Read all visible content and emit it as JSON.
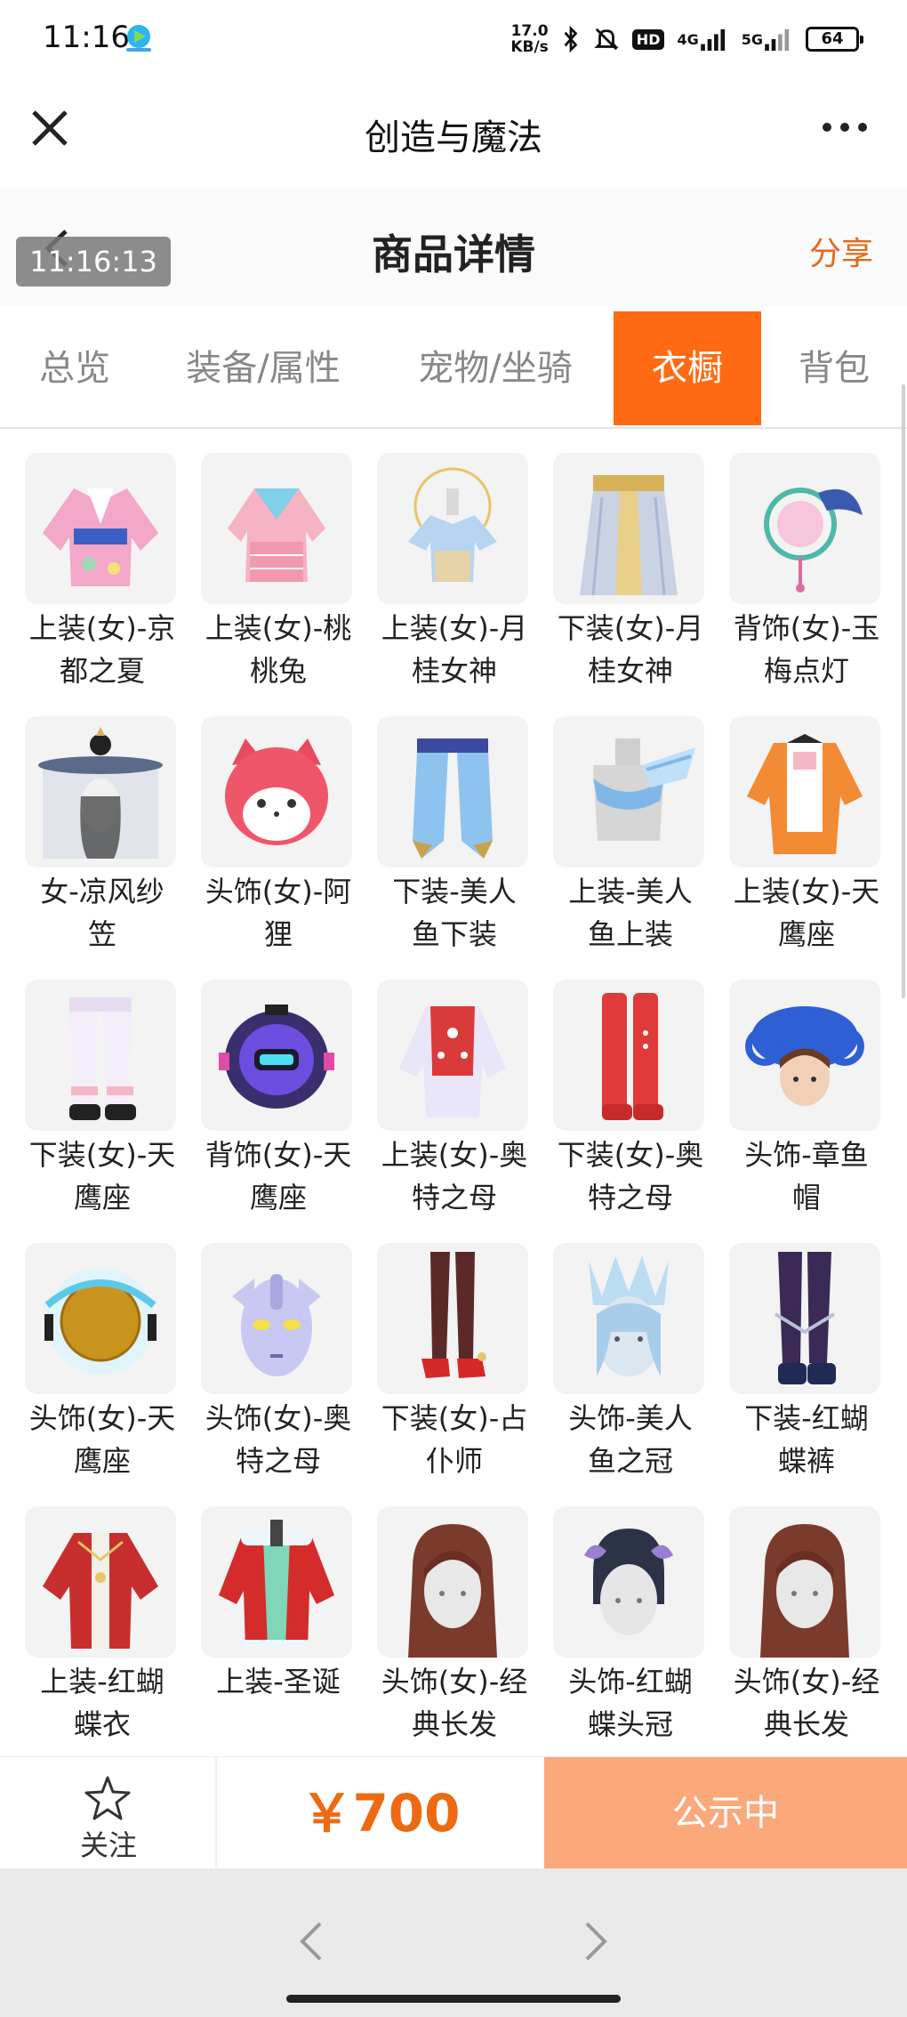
{
  "status_bar": {
    "time": "11:16",
    "net_speed_value": "17.0",
    "net_speed_unit": "KB/s",
    "hd_label": "HD",
    "signal1_label": "4G",
    "signal2_label": "5G",
    "battery": "64"
  },
  "title_bar": {
    "title": "创造与魔法"
  },
  "page_header": {
    "title": "商品详情",
    "share_label": "分享",
    "timestamp_overlay": "11:16:13"
  },
  "tabs": [
    {
      "label": "总览",
      "active": false
    },
    {
      "label": "装备/属性",
      "active": false
    },
    {
      "label": "宠物/坐骑",
      "active": false
    },
    {
      "label": "衣橱",
      "active": true
    },
    {
      "label": "背包",
      "active": false
    }
  ],
  "items": [
    {
      "line1": "上装(女)-京",
      "line2": "都之夏",
      "icon": "kimono-top-icon"
    },
    {
      "line1": "上装(女)-桃",
      "line2": "桃兔",
      "icon": "pink-dress-top-icon"
    },
    {
      "line1": "上装(女)-月",
      "line2": "桂女神",
      "icon": "goddess-top-icon"
    },
    {
      "line1": "下装(女)-月",
      "line2": "桂女神",
      "icon": "goddess-skirt-icon"
    },
    {
      "line1": "背饰(女)-玉",
      "line2": "梅点灯",
      "icon": "lantern-back-icon"
    },
    {
      "line1": "女-凉风纱",
      "line2": "笠",
      "icon": "veil-hat-icon"
    },
    {
      "line1": "头饰(女)-阿",
      "line2": "狸",
      "icon": "fox-head-icon"
    },
    {
      "line1": "下装-美人",
      "line2": "鱼下装",
      "icon": "mermaid-bottom-icon"
    },
    {
      "line1": "上装-美人",
      "line2": "鱼上装",
      "icon": "mermaid-top-icon"
    },
    {
      "line1": "上装(女)-天",
      "line2": "鹰座",
      "icon": "aquila-top-icon"
    },
    {
      "line1": "下装(女)-天",
      "line2": "鹰座",
      "icon": "aquila-pants-icon"
    },
    {
      "line1": "背饰(女)-天",
      "line2": "鹰座",
      "icon": "aquila-back-icon"
    },
    {
      "line1": "上装(女)-奥",
      "line2": "特之母",
      "icon": "ultra-top-icon"
    },
    {
      "line1": "下装(女)-奥",
      "line2": "特之母",
      "icon": "ultra-boots-icon"
    },
    {
      "line1": "头饰-章鱼",
      "line2": "帽",
      "icon": "octopus-hat-icon"
    },
    {
      "line1": "头饰(女)-天",
      "line2": "鹰座",
      "icon": "aquila-helmet-icon"
    },
    {
      "line1": "头饰(女)-奥",
      "line2": "特之母",
      "icon": "ultra-mask-icon"
    },
    {
      "line1": "下装(女)-占",
      "line2": "仆师",
      "icon": "red-heels-icon"
    },
    {
      "line1": "头饰-美人",
      "line2": "鱼之冠",
      "icon": "mermaid-crown-icon"
    },
    {
      "line1": "下装-红蝴",
      "line2": "蝶裤",
      "icon": "butterfly-pants-icon"
    },
    {
      "line1": "上装-红蝴",
      "line2": "蝶衣",
      "icon": "butterfly-top-icon"
    },
    {
      "line1": "上装-圣诞",
      "line2": "",
      "icon": "christmas-top-icon"
    },
    {
      "line1": "头饰(女)-经",
      "line2": "典长发",
      "icon": "long-hair-icon"
    },
    {
      "line1": "头饰-红蝴",
      "line2": "蝶头冠",
      "icon": "butterfly-crown-icon"
    },
    {
      "line1": "头饰(女)-经",
      "line2": "典长发",
      "icon": "long-hair-icon"
    }
  ],
  "action_bar": {
    "follow_label": "关注",
    "price": "￥700",
    "status_label": "公示中"
  },
  "colors": {
    "accent": "#ff6a12",
    "price": "#ee6a12",
    "status_button": "#fba87b",
    "share": "#e5681c"
  }
}
